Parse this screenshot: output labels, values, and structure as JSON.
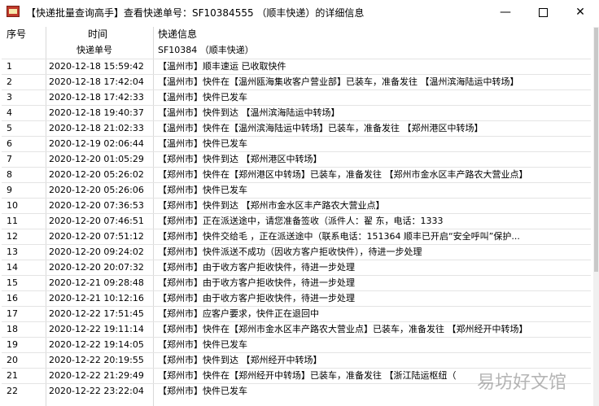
{
  "window": {
    "title": "【快递批量查询高手】查看快递单号：SF10384555 （顺丰快递）的详细信息",
    "minimize_glyph": "—",
    "close_glyph": "✕"
  },
  "table": {
    "headers": {
      "no": "序号",
      "time": "时间",
      "info": "快递信息"
    },
    "sub_header": {
      "label": "快递单号",
      "value": "SF10384 （顺丰快递）"
    },
    "rows": [
      {
        "no": "1",
        "time": "2020-12-18 15:59:42",
        "info": "【温州市】顺丰速运 已收取快件"
      },
      {
        "no": "2",
        "time": "2020-12-18 17:42:04",
        "info": "【温州市】快件在【温州瓯海集收客户营业部】已装车，准备发往 【温州滨海陆运中转场】"
      },
      {
        "no": "3",
        "time": "2020-12-18 17:42:33",
        "info": "【温州市】快件已发车"
      },
      {
        "no": "4",
        "time": "2020-12-18 19:40:37",
        "info": "【温州市】快件到达 【温州滨海陆运中转场】"
      },
      {
        "no": "5",
        "time": "2020-12-18 21:02:33",
        "info": "【温州市】快件在【温州滨海陆运中转场】已装车，准备发往 【郑州港区中转场】"
      },
      {
        "no": "6",
        "time": "2020-12-19 02:06:44",
        "info": "【温州市】快件已发车"
      },
      {
        "no": "7",
        "time": "2020-12-20 01:05:29",
        "info": "【郑州市】快件到达 【郑州港区中转场】"
      },
      {
        "no": "8",
        "time": "2020-12-20 05:26:02",
        "info": "【郑州市】快件在【郑州港区中转场】已装车，准备发往 【郑州市金水区丰产路农大营业点】"
      },
      {
        "no": "9",
        "time": "2020-12-20 05:26:06",
        "info": "【郑州市】快件已发车"
      },
      {
        "no": "10",
        "time": "2020-12-20 07:36:53",
        "info": "【郑州市】快件到达 【郑州市金水区丰产路农大营业点】"
      },
      {
        "no": "11",
        "time": "2020-12-20 07:46:51",
        "info": "【郑州市】正在派送途中，请您准备签收（派件人：翟 东，电话：1333"
      },
      {
        "no": "12",
        "time": "2020-12-20 07:51:12",
        "info": "【郑州市】快件交给毛 ，正在派送途中（联系电话：151364 顺丰已开启“安全呼叫”保护..."
      },
      {
        "no": "13",
        "time": "2020-12-20 09:24:02",
        "info": "【郑州市】快件派送不成功（因收方客户拒收快件），待进一步处理"
      },
      {
        "no": "14",
        "time": "2020-12-20 20:07:32",
        "info": "【郑州市】由于收方客户拒收快件，待进一步处理"
      },
      {
        "no": "15",
        "time": "2020-12-21 09:28:48",
        "info": "【郑州市】由于收方客户拒收快件，待进一步处理"
      },
      {
        "no": "16",
        "time": "2020-12-21 10:12:16",
        "info": "【郑州市】由于收方客户拒收快件，待进一步处理"
      },
      {
        "no": "17",
        "time": "2020-12-22 17:51:45",
        "info": "【郑州市】应客户要求，快件正在退回中"
      },
      {
        "no": "18",
        "time": "2020-12-22 19:11:14",
        "info": "【郑州市】快件在【郑州市金水区丰产路农大营业点】已装车，准备发往 【郑州经开中转场】"
      },
      {
        "no": "19",
        "time": "2020-12-22 19:14:05",
        "info": "【郑州市】快件已发车"
      },
      {
        "no": "20",
        "time": "2020-12-22 20:19:55",
        "info": "【郑州市】快件到达 【郑州经开中转场】"
      },
      {
        "no": "21",
        "time": "2020-12-22 21:29:49",
        "info": "【郑州市】快件在【郑州经开中转场】已装车，准备发往 【浙江陆运枢纽（"
      },
      {
        "no": "22",
        "time": "2020-12-22 23:22:04",
        "info": "【郑州市】快件已发车"
      }
    ]
  },
  "watermark": "易坊好文馆"
}
